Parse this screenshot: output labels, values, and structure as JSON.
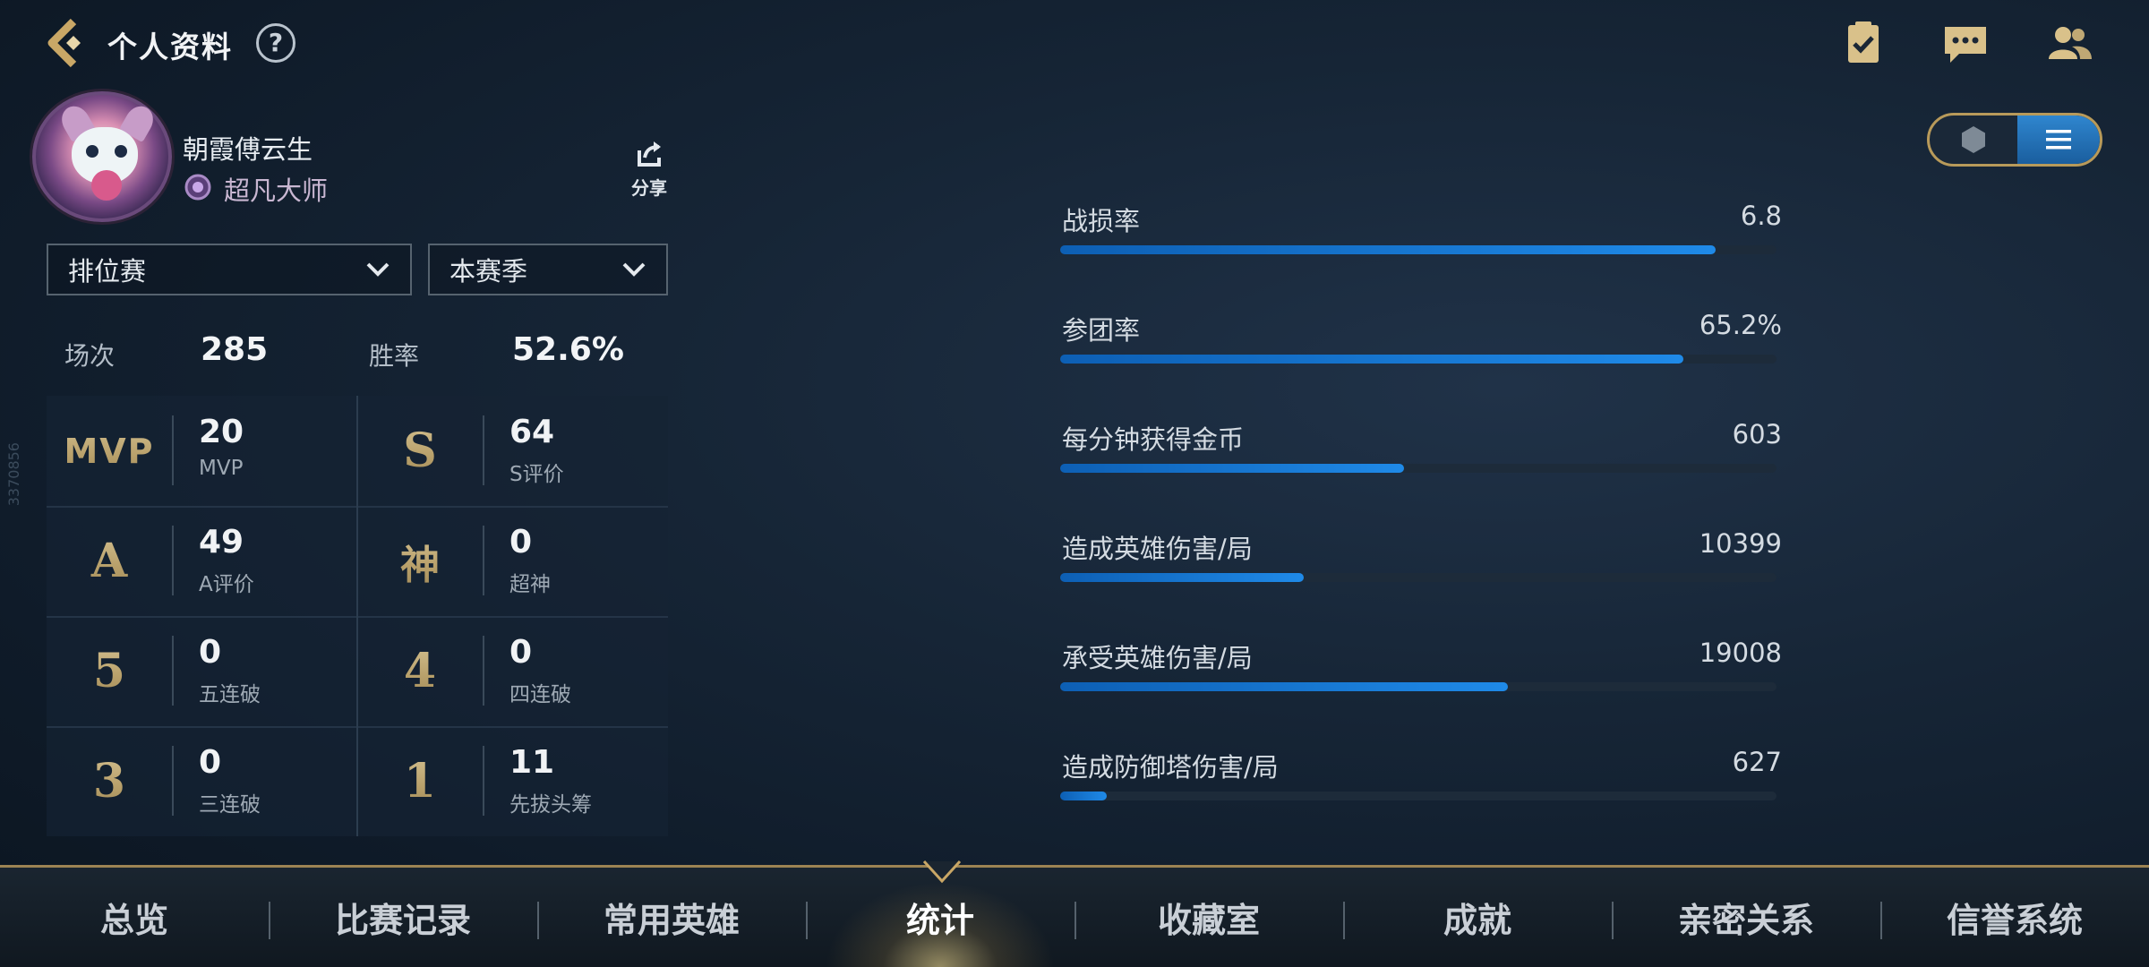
{
  "header": {
    "title": "个人资料",
    "help_symbol": "?"
  },
  "profile": {
    "player_name": "朝霞傅云生",
    "rank": "超凡大师",
    "share_label": "分享"
  },
  "filters": {
    "mode": "排位赛",
    "season": "本赛季"
  },
  "summary": {
    "games_label": "场次",
    "games_value": "285",
    "winrate_label": "胜率",
    "winrate_value": "52.6%"
  },
  "stats": [
    {
      "symbol": "MVP",
      "value": "20",
      "caption": "MVP"
    },
    {
      "symbol": "S",
      "value": "64",
      "caption": "S评价"
    },
    {
      "symbol": "A",
      "value": "49",
      "caption": "A评价"
    },
    {
      "symbol": "神",
      "value": "0",
      "caption": "超神"
    },
    {
      "symbol": "5",
      "value": "0",
      "caption": "五连破"
    },
    {
      "symbol": "4",
      "value": "0",
      "caption": "四连破"
    },
    {
      "symbol": "3",
      "value": "0",
      "caption": "三连破"
    },
    {
      "symbol": "1",
      "value": "11",
      "caption": "先拔头筹"
    }
  ],
  "metrics": [
    {
      "label": "战损率",
      "value": "6.8",
      "fill_fraction": 0.915
    },
    {
      "label": "参团率",
      "value": "65.2%",
      "fill_fraction": 0.87
    },
    {
      "label": "每分钟获得金币",
      "value": "603",
      "fill_fraction": 0.48
    },
    {
      "label": "造成英雄伤害/局",
      "value": "10399",
      "fill_fraction": 0.34
    },
    {
      "label": "承受英雄伤害/局",
      "value": "19008",
      "fill_fraction": 0.625
    },
    {
      "label": "造成防御塔伤害/局",
      "value": "627",
      "fill_fraction": 0.065
    }
  ],
  "view_toggle": {
    "options": [
      "radar-icon",
      "list-icon"
    ],
    "selected": "list-icon"
  },
  "nav": {
    "tabs": [
      "总览",
      "比赛记录",
      "常用英雄",
      "统计",
      "收藏室",
      "成就",
      "亲密关系",
      "信誉系统"
    ],
    "active_index": 3
  },
  "side_code": "3370856",
  "colors": {
    "accent_blue": "#1f8ae8",
    "gold": "#b89a5a"
  }
}
